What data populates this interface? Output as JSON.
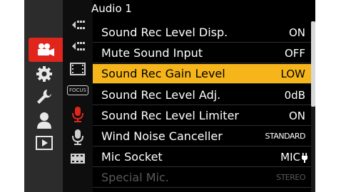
{
  "header": {
    "title": "Audio 1"
  },
  "categories": [
    {
      "icon": "movie-camera-icon",
      "selected": true
    },
    {
      "icon": "gear-icon",
      "selected": false
    },
    {
      "icon": "wrench-icon",
      "selected": false
    },
    {
      "icon": "person-icon",
      "selected": false
    },
    {
      "icon": "playback-icon",
      "selected": false
    }
  ],
  "subtabs": [
    {
      "icon": "diamond-arrow-icon",
      "selected": false
    },
    {
      "icon": "diamond-arrow-icon",
      "selected": false
    },
    {
      "icon": "film-frame-icon",
      "selected": false
    },
    {
      "icon": "focus-icon",
      "label": "FOCUS",
      "selected": false
    },
    {
      "icon": "microphone-icon",
      "selected": true
    },
    {
      "icon": "microphone-icon",
      "selected": false
    },
    {
      "icon": "film-strip-icon",
      "selected": false
    }
  ],
  "menu": [
    {
      "label": "Sound Rec Level Disp.",
      "value": "ON"
    },
    {
      "label": "Mute Sound Input",
      "value": "OFF"
    },
    {
      "label": "Sound Rec Gain Level",
      "value": "LOW",
      "selected": true
    },
    {
      "label": "Sound Rec Level Adj.",
      "value": "0dB"
    },
    {
      "label": "Sound Rec Level Limiter",
      "value": "ON"
    },
    {
      "label": "Wind Noise Canceller",
      "value": "STANDARD"
    },
    {
      "label": "Mic Socket",
      "value": "MIC"
    },
    {
      "label": "Special Mic.",
      "value": "STEREO",
      "disabled": true
    }
  ],
  "colors": {
    "selected_row": "#f5b51b",
    "selected_category": "#e0261c",
    "background": "#000000"
  }
}
